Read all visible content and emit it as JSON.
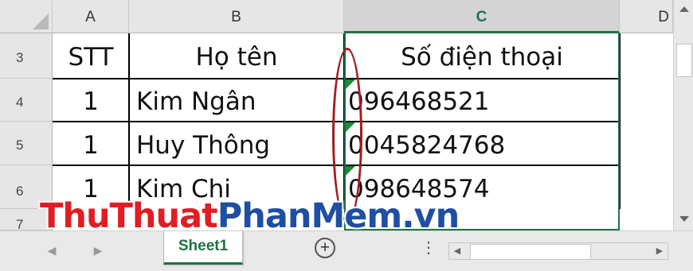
{
  "columns": [
    "A",
    "B",
    "C",
    "D"
  ],
  "rows": [
    {
      "row": "3",
      "stt": "STT",
      "name": "Họ tên",
      "phone": "Số điện thoại"
    },
    {
      "row": "4",
      "stt": "1",
      "name": "Kim Ngân",
      "phone": "096468521"
    },
    {
      "row": "5",
      "stt": "1",
      "name": "Huy Thông",
      "phone": "0045824768"
    },
    {
      "row": "6",
      "stt": "1",
      "name": "Kim Chi",
      "phone": "098648574"
    },
    {
      "row": "7"
    }
  ],
  "sheet_tab": "Sheet1",
  "add_sheet_symbol": "+",
  "watermark": {
    "part1": "ThuThuat",
    "part2": "PhanMem",
    "part3": ".vn"
  },
  "colors": {
    "accent": "#217346",
    "annotation": "#a11d1d",
    "watermark_red": "#e11d24",
    "watermark_blue": "#1f4fa3"
  },
  "icons": [
    "select-all-corner-icon",
    "scroll-up-icon",
    "scroll-down-icon",
    "sheet-prev-icon",
    "sheet-next-icon",
    "add-sheet-icon",
    "tab-split-icon",
    "scroll-left-icon",
    "scroll-right-icon"
  ]
}
